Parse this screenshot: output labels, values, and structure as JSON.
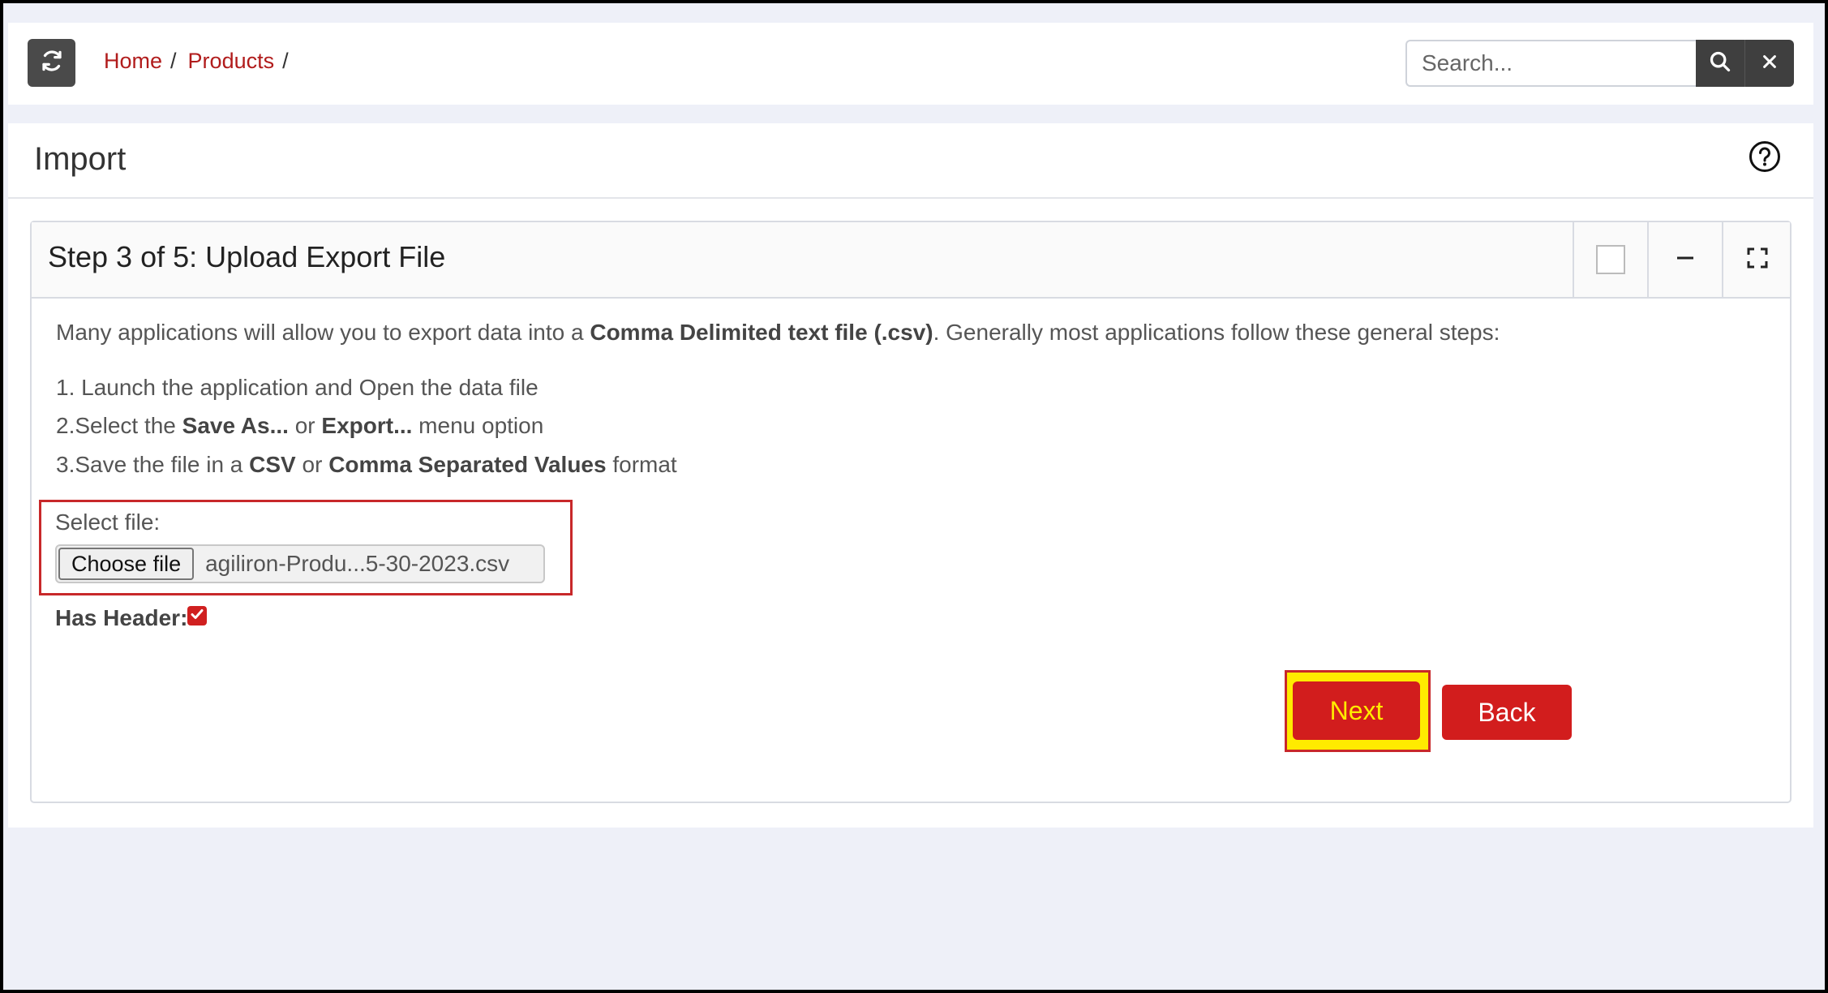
{
  "header": {
    "breadcrumb": [
      {
        "label": "Home"
      },
      {
        "label": "Products"
      }
    ],
    "search": {
      "placeholder": "Search...",
      "value": ""
    }
  },
  "page": {
    "title": "Import"
  },
  "card": {
    "title": "Step 3 of 5: Upload Export File",
    "intro": {
      "pre": "Many applications will allow you to export data into a ",
      "bold": "Comma Delimited text file (.csv)",
      "post": ". Generally most applications follow these general steps:"
    },
    "steps": {
      "s1": "1. Launch the application and Open the data file",
      "s2_pre": "2.Select the ",
      "s2_b1": "Save As...",
      "s2_mid": " or ",
      "s2_b2": "Export...",
      "s2_post": " menu option",
      "s3_pre": "3.Save the file in a ",
      "s3_b1": "CSV",
      "s3_mid": " or ",
      "s3_b2": "Comma Separated Values",
      "s3_post": " format"
    },
    "file": {
      "label": "Select file:",
      "button": "Choose file",
      "filename": "agiliron-Produ...5-30-2023.csv"
    },
    "has_header": {
      "label": "Has Header:",
      "checked": true
    },
    "buttons": {
      "next": "Next",
      "back": "Back"
    }
  },
  "colors": {
    "accent_red": "#d21d1d",
    "link_red": "#b11c1c",
    "highlight_yellow": "#ffeb00",
    "dark_button": "#3f3f3f"
  },
  "icons": [
    "refresh-icon",
    "search-icon",
    "close-icon",
    "help-icon",
    "minimize-icon",
    "fullscreen-icon",
    "checkmark-icon"
  ]
}
